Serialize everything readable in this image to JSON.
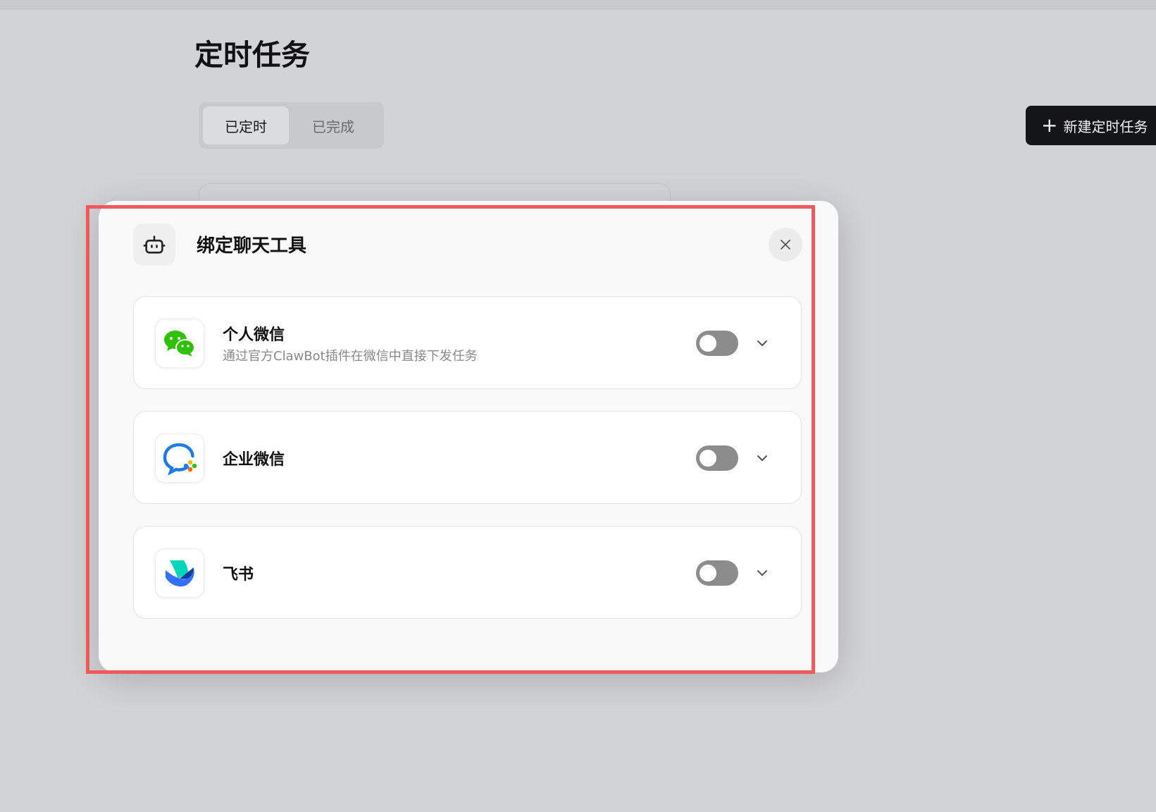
{
  "page": {
    "title": "定时任务"
  },
  "tabs": [
    {
      "label": "已定时",
      "active": true
    },
    {
      "label": "已完成",
      "active": false
    }
  ],
  "new_task_button": {
    "icon": "plus-icon",
    "label": "新建定时任务"
  },
  "modal": {
    "icon": "robot-icon",
    "title": "绑定聊天工具",
    "close_icon": "close-icon",
    "tools": [
      {
        "name": "个人微信",
        "description": "通过官方ClawBot插件在微信中直接下发任务",
        "icon": "wechat-icon",
        "enabled": false
      },
      {
        "name": "企业微信",
        "description": "",
        "icon": "wecom-icon",
        "enabled": false
      },
      {
        "name": "飞书",
        "description": "",
        "icon": "feishu-icon",
        "enabled": false
      }
    ]
  },
  "colors": {
    "highlight": "#f0595c",
    "toggle_off": "#8c8c8c",
    "primary_button": "#141517"
  }
}
